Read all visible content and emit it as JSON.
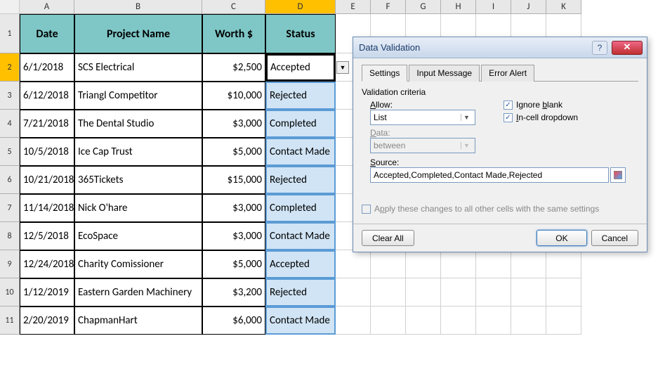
{
  "columns": [
    "A",
    "B",
    "C",
    "D",
    "E",
    "F",
    "G",
    "H",
    "I",
    "J",
    "K"
  ],
  "selected_col": "D",
  "header_row": {
    "date": "Date",
    "project": "Project Name",
    "worth": "Worth $",
    "status": "Status"
  },
  "rows": [
    {
      "n": "2",
      "date": "6/1/2018",
      "project": "SCS Electrical",
      "worth": "$2,500",
      "status": "Accepted",
      "selected": true
    },
    {
      "n": "3",
      "date": "6/12/2018",
      "project": "Triangl Competitor",
      "worth": "$10,000",
      "status": "Rejected"
    },
    {
      "n": "4",
      "date": "7/21/2018",
      "project": "The Dental Studio",
      "worth": "$3,000",
      "status": "Completed"
    },
    {
      "n": "5",
      "date": "10/5/2018",
      "project": "Ice Cap Trust",
      "worth": "$5,000",
      "status": "Contact Made"
    },
    {
      "n": "6",
      "date": "10/21/2018",
      "project": "365Tickets",
      "worth": "$15,000",
      "status": "Rejected"
    },
    {
      "n": "7",
      "date": "11/14/2018",
      "project": "Nick O'hare",
      "worth": "$3,000",
      "status": "Completed"
    },
    {
      "n": "8",
      "date": "12/5/2018",
      "project": "EcoSpace",
      "worth": "$3,000",
      "status": "Contact Made"
    },
    {
      "n": "9",
      "date": "12/24/2018",
      "project": "Charity Comissioner",
      "worth": "$5,000",
      "status": "Accepted"
    },
    {
      "n": "10",
      "date": "1/12/2019",
      "project": "Eastern Garden Machinery",
      "worth": "$3,200",
      "status": "Rejected"
    },
    {
      "n": "11",
      "date": "2/20/2019",
      "project": "ChapmanHart",
      "worth": "$6,000",
      "status": "Contact Made"
    }
  ],
  "dialog": {
    "title": "Data Validation",
    "tabs": {
      "settings": "Settings",
      "input_msg": "Input Message",
      "error_alert": "Error Alert"
    },
    "criteria_label": "Validation criteria",
    "allow_label": "Allow:",
    "allow_value": "List",
    "data_label": "Data:",
    "data_value": "between",
    "ignore_blank": "Ignore blank",
    "incell_dropdown": "In-cell dropdown",
    "source_label": "Source:",
    "source_value": "Accepted,Completed,Contact Made,Rejected",
    "apply_all": "Apply these changes to all other cells with the same settings",
    "clear_all": "Clear All",
    "ok": "OK",
    "cancel": "Cancel"
  }
}
